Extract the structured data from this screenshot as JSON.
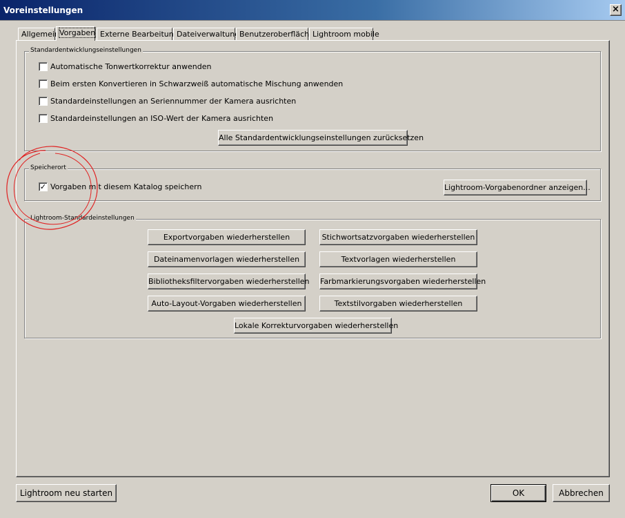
{
  "window": {
    "title": "Voreinstellungen",
    "close_glyph": "×"
  },
  "tabs": [
    {
      "label": "Allgemein"
    },
    {
      "label": "Vorgaben"
    },
    {
      "label": "Externe Bearbeitung"
    },
    {
      "label": "Dateiverwaltung"
    },
    {
      "label": "Benutzeroberfläche"
    },
    {
      "label": "Lightroom mobile"
    }
  ],
  "active_tab": "Vorgaben",
  "standard_dev": {
    "legend": "Standardentwicklungseinstellungen",
    "checkboxes": [
      {
        "label": "Automatische Tonwertkorrektur anwenden",
        "checked": false
      },
      {
        "label": "Beim ersten Konvertieren in Schwarzweiß automatische Mischung anwenden",
        "checked": false
      },
      {
        "label": "Standardeinstellungen an Seriennummer der Kamera ausrichten",
        "checked": false
      },
      {
        "label": "Standardeinstellungen an ISO-Wert der Kamera ausrichten",
        "checked": false
      }
    ],
    "reset_button": "Alle Standardentwicklungseinstellungen zurücksetzen"
  },
  "location": {
    "legend": "Speicherort",
    "checkbox": {
      "label": "Vorgaben mit diesem Katalog speichern",
      "checked": true,
      "glyph": "✓"
    },
    "show_folder_button": "Lightroom-Vorgabenordner anzeigen..."
  },
  "lr_defaults": {
    "legend": "Lightroom-Standardeinstellungen",
    "buttons": [
      "Exportvorgaben wiederherstellen",
      "Stichwortsatzvorgaben wiederherstellen",
      "Dateinamenvorlagen wiederherstellen",
      "Textvorlagen wiederherstellen",
      "Bibliotheksfiltervorgaben wiederherstellen",
      "Farbmarkierungsvorgaben wiederherstellen",
      "Auto-Layout-Vorgaben wiederherstellen",
      "Textstilvorgaben wiederherstellen",
      "Lokale Korrekturvorgaben wiederherstellen"
    ]
  },
  "footer": {
    "restart_button": "Lightroom neu starten",
    "ok_button": "OK",
    "cancel_button": "Abbrechen"
  },
  "colors": {
    "dialog_bg": "#d4d0c8",
    "titlebar_start": "#0a246a",
    "titlebar_end": "#a6caf0",
    "annotation_stroke": "#e02020"
  }
}
